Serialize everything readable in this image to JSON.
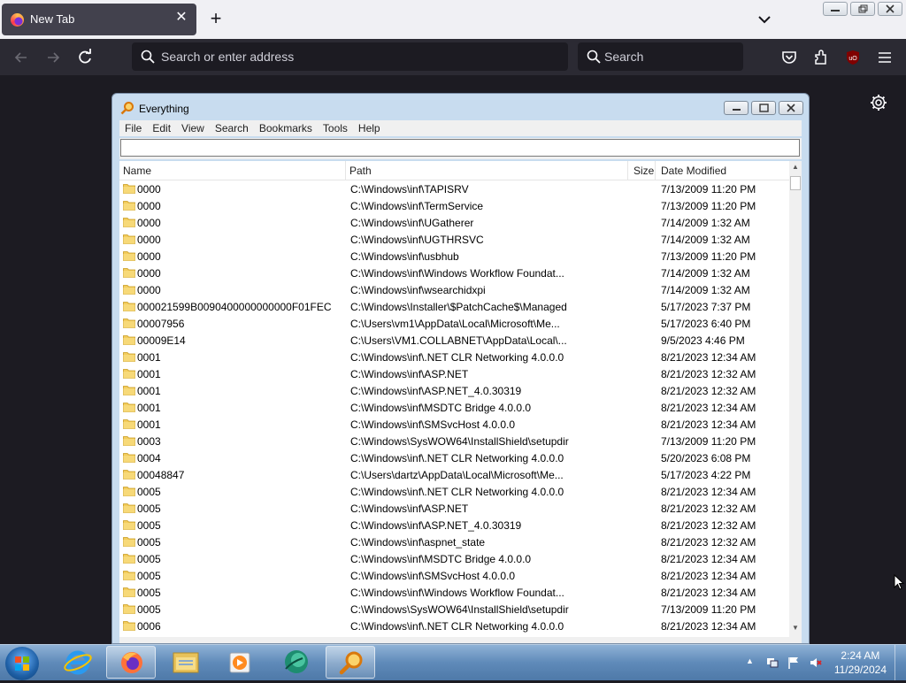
{
  "browser": {
    "tab_title": "New Tab",
    "tab_close": "✕",
    "new_tab": "+",
    "url_placeholder": "Search or enter address",
    "search_placeholder": "Search"
  },
  "everything": {
    "window_title": "Everything",
    "menu": [
      "File",
      "Edit",
      "View",
      "Search",
      "Bookmarks",
      "Tools",
      "Help"
    ],
    "search_value": "",
    "columns": {
      "name": "Name",
      "path": "Path",
      "size": "Size",
      "date_modified": "Date Modified"
    },
    "rows": [
      {
        "name": "0000",
        "path": "C:\\Windows\\inf\\TAPISRV",
        "date": "7/13/2009 11:20 PM"
      },
      {
        "name": "0000",
        "path": "C:\\Windows\\inf\\TermService",
        "date": "7/13/2009 11:20 PM"
      },
      {
        "name": "0000",
        "path": "C:\\Windows\\inf\\UGatherer",
        "date": "7/14/2009 1:32 AM"
      },
      {
        "name": "0000",
        "path": "C:\\Windows\\inf\\UGTHRSVC",
        "date": "7/14/2009 1:32 AM"
      },
      {
        "name": "0000",
        "path": "C:\\Windows\\inf\\usbhub",
        "date": "7/13/2009 11:20 PM"
      },
      {
        "name": "0000",
        "path": "C:\\Windows\\inf\\Windows Workflow Foundat...",
        "date": "7/14/2009 1:32 AM"
      },
      {
        "name": "0000",
        "path": "C:\\Windows\\inf\\wsearchidxpi",
        "date": "7/14/2009 1:32 AM"
      },
      {
        "name": "000021599B0090400000000000F01FEC",
        "path": "C:\\Windows\\Installer\\$PatchCache$\\Managed",
        "date": "5/17/2023 7:37 PM"
      },
      {
        "name": "00007956",
        "path": "C:\\Users\\vm1\\AppData\\Local\\Microsoft\\Me...",
        "date": "5/17/2023 6:40 PM"
      },
      {
        "name": "00009E14",
        "path": "C:\\Users\\VM1.COLLABNET\\AppData\\Local\\...",
        "date": "9/5/2023 4:46 PM"
      },
      {
        "name": "0001",
        "path": "C:\\Windows\\inf\\.NET CLR Networking 4.0.0.0",
        "date": "8/21/2023 12:34 AM"
      },
      {
        "name": "0001",
        "path": "C:\\Windows\\inf\\ASP.NET",
        "date": "8/21/2023 12:32 AM"
      },
      {
        "name": "0001",
        "path": "C:\\Windows\\inf\\ASP.NET_4.0.30319",
        "date": "8/21/2023 12:32 AM"
      },
      {
        "name": "0001",
        "path": "C:\\Windows\\inf\\MSDTC Bridge 4.0.0.0",
        "date": "8/21/2023 12:34 AM"
      },
      {
        "name": "0001",
        "path": "C:\\Windows\\inf\\SMSvcHost 4.0.0.0",
        "date": "8/21/2023 12:34 AM"
      },
      {
        "name": "0003",
        "path": "C:\\Windows\\SysWOW64\\InstallShield\\setupdir",
        "date": "7/13/2009 11:20 PM"
      },
      {
        "name": "0004",
        "path": "C:\\Windows\\inf\\.NET CLR Networking 4.0.0.0",
        "date": "5/20/2023 6:08 PM"
      },
      {
        "name": "00048847",
        "path": "C:\\Users\\dartz\\AppData\\Local\\Microsoft\\Me...",
        "date": "5/17/2023 4:22 PM"
      },
      {
        "name": "0005",
        "path": "C:\\Windows\\inf\\.NET CLR Networking 4.0.0.0",
        "date": "8/21/2023 12:34 AM"
      },
      {
        "name": "0005",
        "path": "C:\\Windows\\inf\\ASP.NET",
        "date": "8/21/2023 12:32 AM"
      },
      {
        "name": "0005",
        "path": "C:\\Windows\\inf\\ASP.NET_4.0.30319",
        "date": "8/21/2023 12:32 AM"
      },
      {
        "name": "0005",
        "path": "C:\\Windows\\inf\\aspnet_state",
        "date": "8/21/2023 12:32 AM"
      },
      {
        "name": "0005",
        "path": "C:\\Windows\\inf\\MSDTC Bridge 4.0.0.0",
        "date": "8/21/2023 12:34 AM"
      },
      {
        "name": "0005",
        "path": "C:\\Windows\\inf\\SMSvcHost 4.0.0.0",
        "date": "8/21/2023 12:34 AM"
      },
      {
        "name": "0005",
        "path": "C:\\Windows\\inf\\Windows Workflow Foundat...",
        "date": "8/21/2023 12:34 AM"
      },
      {
        "name": "0005",
        "path": "C:\\Windows\\SysWOW64\\InstallShield\\setupdir",
        "date": "7/13/2009 11:20 PM"
      },
      {
        "name": "0006",
        "path": "C:\\Windows\\inf\\.NET CLR Networking 4.0.0.0",
        "date": "8/21/2023 12:34 AM"
      }
    ]
  },
  "taskbar": {
    "items": [
      "start-orb",
      "internet-explorer-icon",
      "firefox-icon",
      "file-explorer-icon",
      "media-player-icon",
      "app-globe-icon",
      "everything-search-icon"
    ],
    "clock_time": "2:24 AM",
    "clock_date": "11/29/2024"
  },
  "colors": {
    "accent": "#2b2a33",
    "window_frame": "#c8dcef",
    "taskbar": "#5f8ab9"
  }
}
